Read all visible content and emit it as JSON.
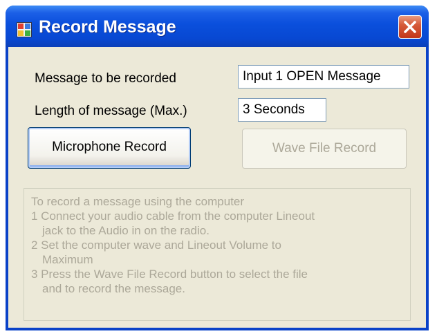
{
  "window": {
    "title": "Record Message",
    "icons": {
      "app": "app-window-icon",
      "close": "close-icon"
    },
    "colors": {
      "title_bar": "#0a4fdc",
      "close_button": "#c2361a",
      "client_bg": "#ece9d8",
      "disabled_text": "#aca899"
    }
  },
  "form": {
    "message_label": "Message to be recorded",
    "message_value": "Input 1 OPEN Message",
    "length_label": "Length of message (Max.)",
    "length_value": "3 Seconds"
  },
  "buttons": {
    "microphone_record": "Microphone Record",
    "wave_file_record": "Wave File Record"
  },
  "instructions": [
    "To record a message using the computer",
    "1  Connect your audio cable from the computer Lineout",
    "jack to the Audio in on the radio.",
    "2  Set the computer wave and Lineout Volume to",
    "Maximum",
    "3  Press the Wave File Record button to select the file",
    "and to record the message."
  ]
}
